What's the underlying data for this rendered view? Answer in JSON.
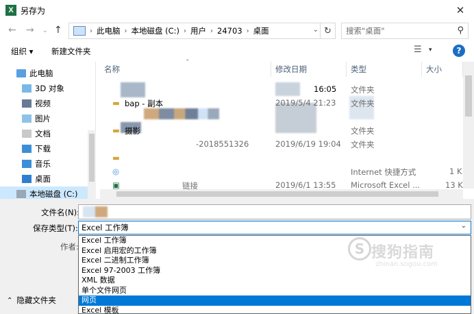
{
  "window": {
    "title": "另存为",
    "app_icon": "excel-icon",
    "close_glyph": "✕"
  },
  "nav": {
    "back": "←",
    "forward": "→",
    "recent": "⌄",
    "up": "↑",
    "breadcrumb": [
      "此电脑",
      "本地磁盘 (C:)",
      "用户",
      "24703",
      "桌面"
    ],
    "dropdown_glyph": "⌄",
    "refresh_glyph": "↻",
    "search_placeholder": "搜索\"桌面\"",
    "search_glyph": "⚲"
  },
  "toolbar": {
    "organize": "组织 ▾",
    "new_folder": "新建文件夹",
    "view_glyph": "☰",
    "view_drop": "▾",
    "help": "?"
  },
  "sidebar": {
    "items": [
      {
        "label": "此电脑",
        "icon": "pc-icon"
      },
      {
        "label": "3D 对象",
        "icon": "cube-icon"
      },
      {
        "label": "视频",
        "icon": "video-icon"
      },
      {
        "label": "图片",
        "icon": "pictures-icon"
      },
      {
        "label": "文档",
        "icon": "documents-icon"
      },
      {
        "label": "下载",
        "icon": "download-icon"
      },
      {
        "label": "音乐",
        "icon": "music-icon"
      },
      {
        "label": "桌面",
        "icon": "desktop-icon"
      },
      {
        "label": "本地磁盘 (C:)",
        "icon": "drive-icon"
      }
    ]
  },
  "columns": [
    "名称",
    "修改日期",
    "类型",
    "大小"
  ],
  "files": [
    {
      "name": "",
      "date": "16:05",
      "type": "文件夹",
      "size": ""
    },
    {
      "name": "bap - 副本",
      "date": "2019/5/4 21:23",
      "type": "文件夹",
      "size": ""
    },
    {
      "name": "",
      "date": "",
      "type": "",
      "size": ""
    },
    {
      "name": "摄影",
      "date": "",
      "type": "文件夹",
      "size": ""
    },
    {
      "name": "-2018551326",
      "date": "2019/6/19 19:04",
      "type": "文件夹",
      "size": ""
    },
    {
      "name": "",
      "date": "",
      "type": "",
      "size": ""
    },
    {
      "name": "",
      "date": "",
      "type": "Internet 快捷方式",
      "size": "1 K"
    },
    {
      "name": "链接",
      "date": "2019/6/1 13:55",
      "type": "Microsoft Excel ...",
      "size": "13 K"
    }
  ],
  "form": {
    "filename_label": "文件名(N):",
    "filename_value": "",
    "savetype_label": "保存类型(T):",
    "savetype_value": "Excel 工作簿",
    "author_label": "作者:",
    "hide_folders": "隐藏文件夹"
  },
  "savetype_options": [
    "Excel 工作簿",
    "Excel 启用宏的工作簿",
    "Excel 二进制工作簿",
    "Excel 97-2003 工作簿",
    "XML 数据",
    "单个文件网页",
    "网页",
    "Excel 模板"
  ],
  "selected_option_index": 6,
  "watermark": {
    "text": "搜狗指南",
    "circle": "S",
    "url": "zhinan.sogou.com"
  }
}
